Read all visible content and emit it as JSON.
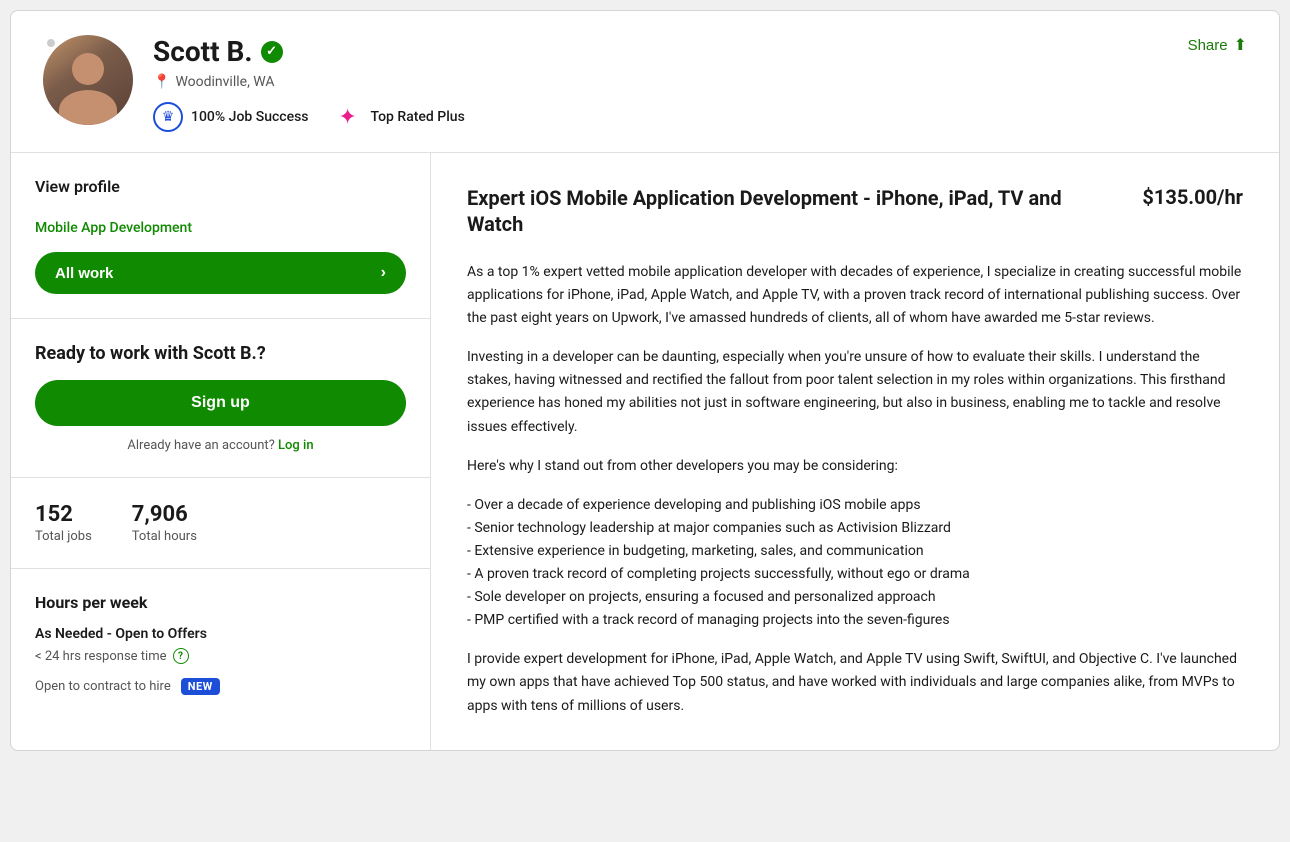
{
  "header": {
    "name": "Scott B.",
    "verified": true,
    "location": "Woodinville, WA",
    "job_success_label": "100% Job Success",
    "top_rated_label": "Top Rated Plus",
    "share_label": "Share"
  },
  "sidebar": {
    "view_profile_label": "View profile",
    "category_link": "Mobile App Development",
    "all_work_label": "All work",
    "ready_title": "Ready to work with Scott B.?",
    "signup_label": "Sign up",
    "login_prompt": "Already have an account?",
    "login_link": "Log in",
    "stats": {
      "total_jobs_value": "152",
      "total_jobs_label": "Total jobs",
      "total_hours_value": "7,906",
      "total_hours_label": "Total hours"
    },
    "hours_section": {
      "title": "Hours per week",
      "availability": "As Needed - Open to Offers",
      "response_time": "< 24 hrs response time",
      "contract_label": "Open to contract to hire",
      "new_badge": "NEW"
    }
  },
  "main": {
    "job_title": "Expert iOS Mobile Application Development - iPhone, iPad, TV and Watch",
    "rate": "$135.00/hr",
    "description_paragraphs": [
      "As a top 1% expert vetted mobile application developer with decades of experience, I specialize in creating successful mobile applications for iPhone, iPad, Apple Watch, and Apple TV, with a proven track record of international publishing success. Over the past eight years on Upwork, I've amassed hundreds of clients, all of whom have awarded me 5-star reviews.",
      "Investing in a developer can be daunting, especially when you're unsure of how to evaluate their skills. I understand the stakes, having witnessed and rectified the fallout from poor talent selection in my roles within organizations. This firsthand experience has honed my abilities not just in software engineering, but also in business, enabling me to tackle and resolve issues effectively.",
      "Here's why I stand out from other developers you may be considering:",
      "- Over a decade of experience developing and publishing iOS mobile apps\n- Senior technology leadership at major companies such as Activision Blizzard\n- Extensive experience in budgeting, marketing, sales, and communication\n- A proven track record of completing projects successfully, without ego or drama\n- Sole developer on projects, ensuring a focused and personalized approach\n- PMP certified with a track record of managing projects into the seven-figures",
      "I provide expert development for iPhone, iPad, Apple Watch, and Apple TV using Swift, SwiftUI, and Objective C. I've launched my own apps that have achieved Top 500 status, and have worked with individuals and large companies alike, from MVPs to apps with tens of millions of users."
    ]
  }
}
